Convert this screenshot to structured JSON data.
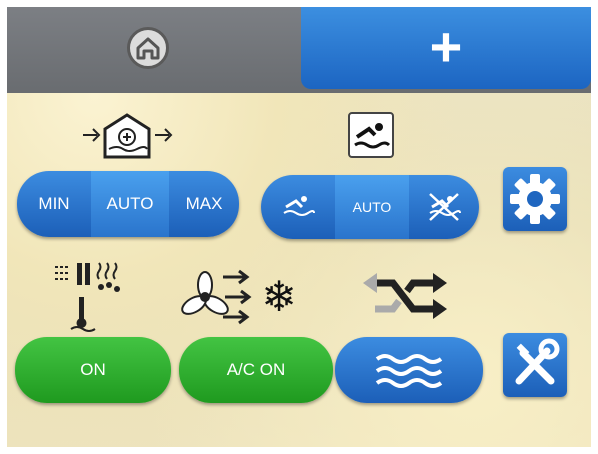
{
  "tabs": [
    {
      "name": "home",
      "icon": "home-icon"
    },
    {
      "name": "add",
      "label": "+"
    }
  ],
  "vent_mode": {
    "icon": "house-fan-icon",
    "options": [
      "MIN",
      "AUTO",
      "MAX"
    ],
    "selected": "AUTO"
  },
  "pool_mode": {
    "icon": "swimmer-icon",
    "options": [
      "swim-icon",
      "AUTO",
      "no-swim-icon"
    ],
    "selected": "AUTO",
    "label": "AUTO"
  },
  "dehum": {
    "icon": "heater-drops-icon",
    "label": "ON"
  },
  "ac": {
    "icon": "fan-snowflake-icon",
    "label": "A/C ON"
  },
  "mix": {
    "icon": "crossing-arrows-icon",
    "button_icon": "waves-icon"
  },
  "side_buttons": {
    "settings": "gear-icon",
    "tools": "tools-icon"
  },
  "colors": {
    "blue": "#1c65c2",
    "green": "#2faf2f",
    "topbar": "#707378"
  }
}
